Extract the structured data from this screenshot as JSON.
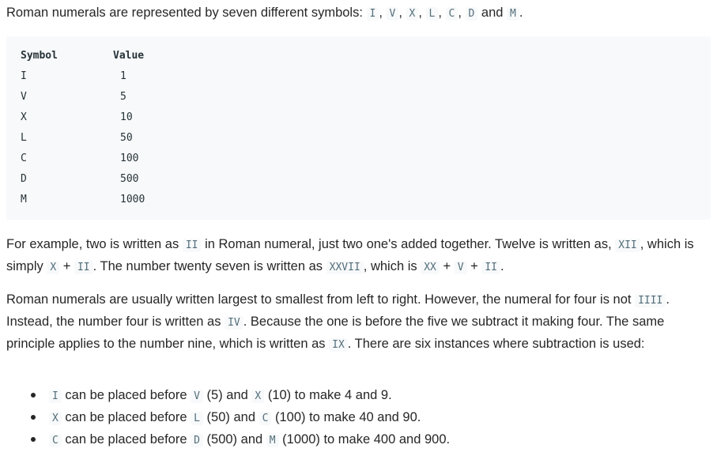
{
  "intro": {
    "t1": "Roman numerals are represented by seven different symbols: ",
    "c1": "I",
    "s1": ", ",
    "c2": "V",
    "s2": ", ",
    "c3": "X",
    "s3": ", ",
    "c4": "L",
    "s4": ", ",
    "c5": "C",
    "s5": ", ",
    "c6": "D",
    "s6": " and ",
    "c7": "M",
    "t2": "."
  },
  "table": {
    "header_symbol": "Symbol",
    "header_value": "Value",
    "rows": [
      {
        "symbol": "I",
        "value": "1"
      },
      {
        "symbol": "V",
        "value": "5"
      },
      {
        "symbol": "X",
        "value": "10"
      },
      {
        "symbol": "L",
        "value": "50"
      },
      {
        "symbol": "C",
        "value": "100"
      },
      {
        "symbol": "D",
        "value": "500"
      },
      {
        "symbol": "M",
        "value": "1000"
      }
    ]
  },
  "para1": {
    "t1": "For example, two is written as ",
    "c1": "II",
    "t2": " in Roman numeral, just two one's added together. Twelve is written as, ",
    "c2": "XII",
    "t3": ", which is simply ",
    "c3": "X",
    "t4": " + ",
    "c4": "II",
    "t5": ". The number twenty seven is written as ",
    "c5": "XXVII",
    "t6": ", which is ",
    "c6": "XX",
    "t7": " + ",
    "c7": "V",
    "t8": " + ",
    "c8": "II",
    "t9": "."
  },
  "para2": {
    "t1": "Roman numerals are usually written largest to smallest from left to right. However, the numeral for four is not ",
    "c1": "IIII",
    "t2": ". Instead, the number four is written as ",
    "c2": "IV",
    "t3": ". Because the one is before the five we subtract it making four. The same principle applies to the number nine, which is written as ",
    "c3": "IX",
    "t4": ". There are six instances where subtraction is used:"
  },
  "bullets": [
    {
      "c1": "I",
      "t1": " can be placed before ",
      "c2": "V",
      "t2": " (5) and ",
      "c3": "X",
      "t3": " (10) to make 4 and 9."
    },
    {
      "c1": "X",
      "t1": " can be placed before ",
      "c2": "L",
      "t2": " (50) and ",
      "c3": "C",
      "t3": " (100) to make 40 and 90."
    },
    {
      "c1": "C",
      "t1": " can be placed before ",
      "c2": "D",
      "t2": " (500) and ",
      "c3": "M",
      "t3": " (1000) to make 400 and 900."
    }
  ]
}
